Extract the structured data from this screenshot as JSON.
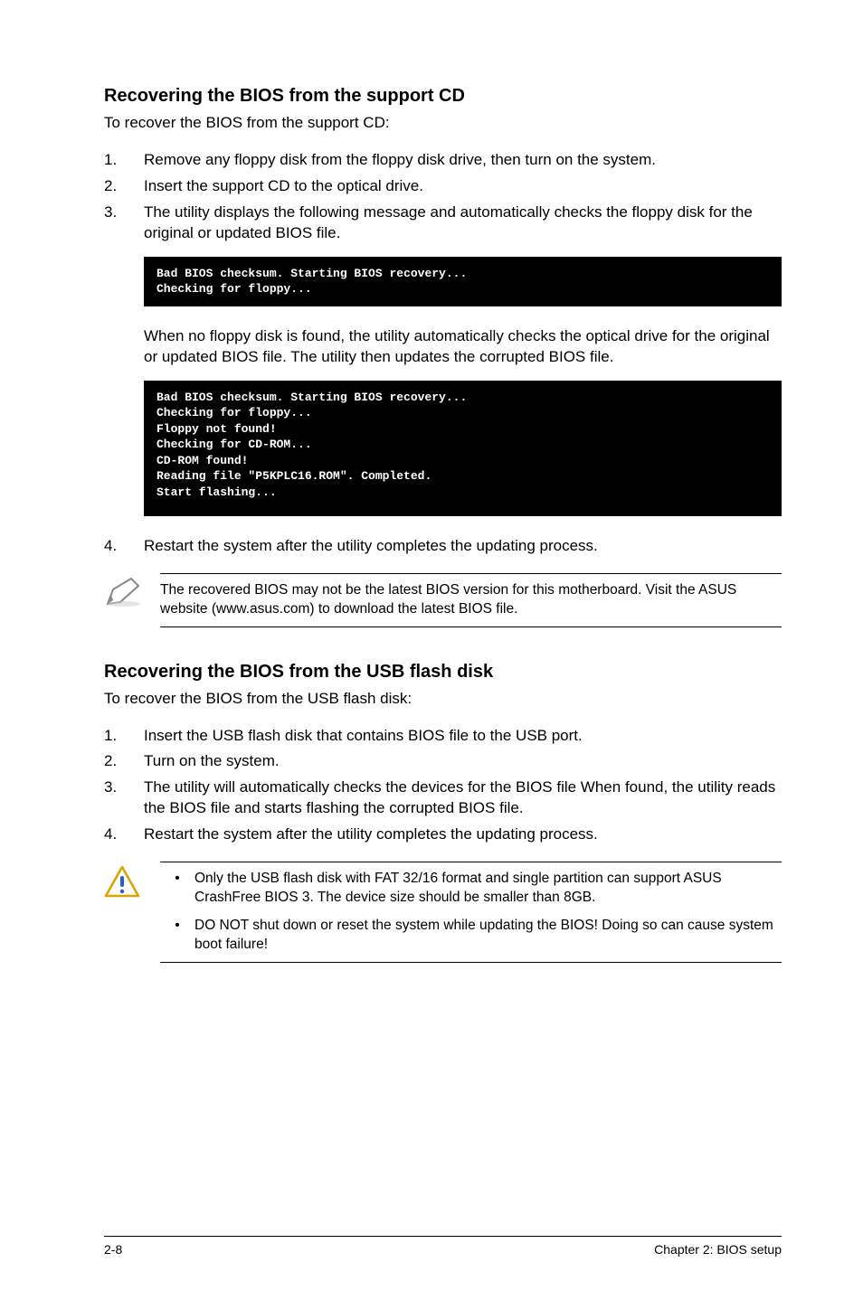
{
  "section1": {
    "heading": "Recovering the BIOS from the support CD",
    "intro": "To recover the BIOS from the support CD:",
    "steps": {
      "s1": {
        "n": "1.",
        "t": "Remove any floppy disk from the floppy disk drive, then turn on the system."
      },
      "s2": {
        "n": "2.",
        "t": "Insert the support CD to the optical drive."
      },
      "s3": {
        "n": "3.",
        "t": "The utility displays the following message and automatically checks the floppy disk for the original or updated BIOS file."
      }
    },
    "term1": "Bad BIOS checksum. Starting BIOS recovery...\nChecking for floppy...",
    "para_after_term1": "When no floppy disk is found, the utility automatically checks the optical drive for the original or updated BIOS file. The utility then updates the corrupted BIOS file.",
    "term2": "Bad BIOS checksum. Starting BIOS recovery...\nChecking for floppy...\nFloppy not found!\nChecking for CD-ROM...\nCD-ROM found!\nReading file \"P5KPLC16.ROM\". Completed.\nStart flashing...",
    "step4": {
      "n": "4.",
      "t": "Restart the system after the utility completes the updating process."
    },
    "note": "The recovered BIOS may not be the latest BIOS version for this motherboard. Visit the ASUS website (www.asus.com) to download the latest BIOS file."
  },
  "section2": {
    "heading": "Recovering the BIOS from the USB flash disk",
    "intro": "To recover the BIOS from the USB flash disk:",
    "steps": {
      "s1": {
        "n": "1.",
        "t": "Insert the USB flash disk that contains BIOS file to the USB port."
      },
      "s2": {
        "n": "2.",
        "t": "Turn on the system."
      },
      "s3": {
        "n": "3.",
        "t": "The utility will automatically checks the devices for the BIOS file When found, the utility reads the BIOS file and starts flashing the corrupted BIOS file."
      },
      "s4": {
        "n": "4.",
        "t": "Restart the system after the utility completes the updating process."
      }
    },
    "warn": {
      "b1": "Only the USB flash disk with FAT 32/16 format and single partition can support ASUS CrashFree BIOS 3. The device size should be smaller than 8GB.",
      "b2": "DO NOT shut down or reset the system while updating the BIOS! Doing so can cause system boot failure!"
    }
  },
  "footer": {
    "left": "2-8",
    "right": "Chapter 2: BIOS setup"
  }
}
